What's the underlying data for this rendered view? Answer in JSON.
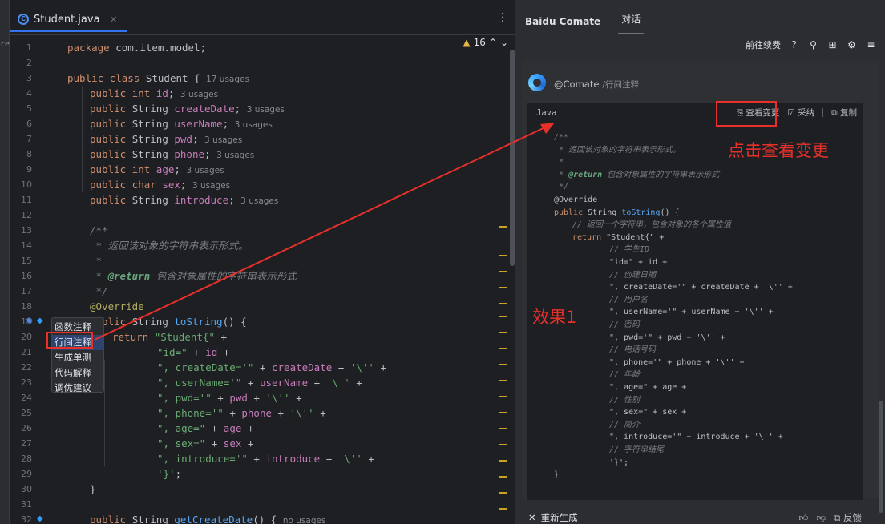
{
  "editor": {
    "tab_name": "Student.java",
    "tab_icon_letter": "C",
    "tab_close": "×",
    "kebab": "⋮",
    "warnings": "16",
    "left_fragment": "re\\",
    "line_numbers": [
      "1",
      "2",
      "3",
      "4",
      "5",
      "6",
      "7",
      "8",
      "9",
      "10",
      "11",
      "12",
      "13",
      "14",
      "15",
      "16",
      "17",
      "18",
      "19",
      "20",
      "21",
      "22",
      "23",
      "24",
      "25",
      "26",
      "27",
      "28",
      "29",
      "30",
      "31",
      "32"
    ]
  },
  "code_lines": [
    {
      "n": 0,
      "indent": 0,
      "parts": [
        [
          "kw",
          "package "
        ],
        [
          "t",
          "com.item.model;"
        ]
      ]
    },
    {
      "n": 2,
      "indent": 0,
      "parts": [
        [
          "kw",
          "public class "
        ],
        [
          "t",
          "Student { "
        ],
        [
          "hint",
          "17 usages"
        ]
      ]
    },
    {
      "n": 3,
      "indent": 1,
      "parts": [
        [
          "kw",
          "public int "
        ],
        [
          "fld",
          "id"
        ],
        [
          "t",
          "; "
        ],
        [
          "hint",
          "3 usages"
        ]
      ]
    },
    {
      "n": 4,
      "indent": 1,
      "parts": [
        [
          "kw",
          "public "
        ],
        [
          "t",
          "String "
        ],
        [
          "fld",
          "createDate"
        ],
        [
          "t",
          "; "
        ],
        [
          "hint",
          "3 usages"
        ]
      ]
    },
    {
      "n": 5,
      "indent": 1,
      "parts": [
        [
          "kw",
          "public "
        ],
        [
          "t",
          "String "
        ],
        [
          "fld",
          "userName"
        ],
        [
          "t",
          "; "
        ],
        [
          "hint",
          "3 usages"
        ]
      ]
    },
    {
      "n": 6,
      "indent": 1,
      "parts": [
        [
          "kw",
          "public "
        ],
        [
          "t",
          "String "
        ],
        [
          "fld",
          "pwd"
        ],
        [
          "t",
          "; "
        ],
        [
          "hint",
          "3 usages"
        ]
      ]
    },
    {
      "n": 7,
      "indent": 1,
      "parts": [
        [
          "kw",
          "public "
        ],
        [
          "t",
          "String "
        ],
        [
          "fld",
          "phone"
        ],
        [
          "t",
          "; "
        ],
        [
          "hint",
          "3 usages"
        ]
      ]
    },
    {
      "n": 8,
      "indent": 1,
      "parts": [
        [
          "kw",
          "public int "
        ],
        [
          "fld",
          "age"
        ],
        [
          "t",
          "; "
        ],
        [
          "hint",
          "3 usages"
        ]
      ]
    },
    {
      "n": 9,
      "indent": 1,
      "parts": [
        [
          "kw",
          "public char "
        ],
        [
          "fld",
          "sex"
        ],
        [
          "t",
          "; "
        ],
        [
          "hint",
          "3 usages"
        ]
      ]
    },
    {
      "n": 10,
      "indent": 1,
      "parts": [
        [
          "kw",
          "public "
        ],
        [
          "t",
          "String "
        ],
        [
          "fld",
          "introduce"
        ],
        [
          "t",
          "; "
        ],
        [
          "hint",
          "3 usages"
        ]
      ]
    },
    {
      "n": 12,
      "indent": 1,
      "parts": [
        [
          "cmt",
          "/**"
        ]
      ]
    },
    {
      "n": 13,
      "indent": 1,
      "parts": [
        [
          "cmt",
          " * 返回该对象的字符串表示形式。"
        ]
      ]
    },
    {
      "n": 14,
      "indent": 1,
      "parts": [
        [
          "cmt",
          " *"
        ]
      ]
    },
    {
      "n": 15,
      "indent": 1,
      "parts": [
        [
          "cmt",
          " * "
        ],
        [
          "tag",
          "@return"
        ],
        [
          "cmt",
          " 包含对象属性的字符串表示形式"
        ]
      ]
    },
    {
      "n": 16,
      "indent": 1,
      "parts": [
        [
          "cmt",
          " */"
        ]
      ]
    },
    {
      "n": 17,
      "indent": 1,
      "parts": [
        [
          "ann",
          "@Override"
        ]
      ]
    },
    {
      "n": 18,
      "indent": 1,
      "parts": [
        [
          "kw",
          "public "
        ],
        [
          "t",
          "String "
        ],
        [
          "fn",
          "toString"
        ],
        [
          "t",
          "() {"
        ]
      ]
    },
    {
      "n": 19,
      "indent": 2,
      "parts": [
        [
          "kw",
          "return "
        ],
        [
          "str",
          "\"Student{\""
        ],
        [
          "t",
          " +"
        ]
      ]
    },
    {
      "n": 20,
      "indent": 4,
      "parts": [
        [
          "str",
          "\"id=\""
        ],
        [
          "t",
          " + "
        ],
        [
          "fld",
          "id"
        ],
        [
          "t",
          " +"
        ]
      ]
    },
    {
      "n": 21,
      "indent": 4,
      "parts": [
        [
          "str",
          "\", createDate='\""
        ],
        [
          "t",
          " + "
        ],
        [
          "fld",
          "createDate"
        ],
        [
          "t",
          " + "
        ],
        [
          "str",
          "'\\''"
        ],
        [
          "t",
          " +"
        ]
      ]
    },
    {
      "n": 22,
      "indent": 4,
      "parts": [
        [
          "str",
          "\", userName='\""
        ],
        [
          "t",
          " + "
        ],
        [
          "fld",
          "userName"
        ],
        [
          "t",
          " + "
        ],
        [
          "str",
          "'\\''"
        ],
        [
          "t",
          " +"
        ]
      ]
    },
    {
      "n": 23,
      "indent": 4,
      "parts": [
        [
          "str",
          "\", pwd='\""
        ],
        [
          "t",
          " + "
        ],
        [
          "fld",
          "pwd"
        ],
        [
          "t",
          " + "
        ],
        [
          "str",
          "'\\''"
        ],
        [
          "t",
          " +"
        ]
      ]
    },
    {
      "n": 24,
      "indent": 4,
      "parts": [
        [
          "str",
          "\", phone='\""
        ],
        [
          "t",
          " + "
        ],
        [
          "fld",
          "phone"
        ],
        [
          "t",
          " + "
        ],
        [
          "str",
          "'\\''"
        ],
        [
          "t",
          " +"
        ]
      ]
    },
    {
      "n": 25,
      "indent": 4,
      "parts": [
        [
          "str",
          "\", age=\""
        ],
        [
          "t",
          " + "
        ],
        [
          "fld",
          "age"
        ],
        [
          "t",
          " +"
        ]
      ]
    },
    {
      "n": 26,
      "indent": 4,
      "parts": [
        [
          "str",
          "\", sex=\""
        ],
        [
          "t",
          " + "
        ],
        [
          "fld",
          "sex"
        ],
        [
          "t",
          " +"
        ]
      ]
    },
    {
      "n": 27,
      "indent": 4,
      "parts": [
        [
          "str",
          "\", introduce='\""
        ],
        [
          "t",
          " + "
        ],
        [
          "fld",
          "introduce"
        ],
        [
          "t",
          " + "
        ],
        [
          "str",
          "'\\''"
        ],
        [
          "t",
          " +"
        ]
      ]
    },
    {
      "n": 28,
      "indent": 4,
      "parts": [
        [
          "str",
          "'}'"
        ],
        [
          "t",
          ";"
        ]
      ]
    },
    {
      "n": 29,
      "indent": 1,
      "parts": [
        [
          "t",
          "}"
        ]
      ]
    },
    {
      "n": 31,
      "indent": 1,
      "parts": [
        [
          "kw",
          "public "
        ],
        [
          "t",
          "String "
        ],
        [
          "fn",
          "getCreateDate"
        ],
        [
          "t",
          "() { "
        ],
        [
          "hint",
          "no usages"
        ]
      ]
    }
  ],
  "popup_menu": [
    "函数注释",
    "行间注释",
    "生成单测",
    "代码解释",
    "调优建议"
  ],
  "panel": {
    "title": "Baidu Comate",
    "tab": "对话",
    "continue_label": "前往续费",
    "sender": "@Comate",
    "command": "/行间注释",
    "lang": "Java",
    "view_change": "查看变更",
    "adopt": "采纳",
    "copy": "复制",
    "regenerate": "重新生成",
    "feedback": "反馈",
    "icons": [
      "help-icon",
      "share-icon",
      "grid-icon",
      "settings-icon",
      "menu-icon"
    ]
  },
  "panel_code": [
    {
      "i": 0,
      "parts": [
        [
          "cmt",
          "/**"
        ]
      ]
    },
    {
      "i": 0,
      "parts": [
        [
          "cmt",
          " * 返回该对象的字符串表示形式。"
        ]
      ]
    },
    {
      "i": 0,
      "parts": [
        [
          "cmt",
          " *"
        ]
      ]
    },
    {
      "i": 0,
      "parts": [
        [
          "cmt",
          " * "
        ],
        [
          "tag",
          "@return"
        ],
        [
          "cmt",
          " 包含对象属性的字符串表示形式"
        ]
      ]
    },
    {
      "i": 0,
      "parts": [
        [
          "cmt",
          " */"
        ]
      ]
    },
    {
      "i": 0,
      "parts": [
        [
          "t",
          "@Override"
        ]
      ]
    },
    {
      "i": 0,
      "parts": [
        [
          "kw",
          "public "
        ],
        [
          "t",
          "String "
        ],
        [
          "fn",
          "toString"
        ],
        [
          "t",
          "() {"
        ]
      ]
    },
    {
      "i": 1,
      "parts": [
        [
          "cmt",
          "// 返回一个字符串，包含对象的各个属性值"
        ]
      ]
    },
    {
      "i": 1,
      "parts": [
        [
          "kw",
          "return "
        ],
        [
          "t",
          "\"Student{\" +"
        ]
      ]
    },
    {
      "i": 3,
      "parts": [
        [
          "cmt",
          "// 学生ID"
        ]
      ]
    },
    {
      "i": 3,
      "parts": [
        [
          "t",
          "\"id=\" + id +"
        ]
      ]
    },
    {
      "i": 3,
      "parts": [
        [
          "cmt",
          "// 创建日期"
        ]
      ]
    },
    {
      "i": 3,
      "parts": [
        [
          "t",
          "\", createDate='\" + createDate + '\\'' +"
        ]
      ]
    },
    {
      "i": 3,
      "parts": [
        [
          "cmt",
          "// 用户名"
        ]
      ]
    },
    {
      "i": 3,
      "parts": [
        [
          "t",
          "\", userName='\" + userName + '\\'' +"
        ]
      ]
    },
    {
      "i": 3,
      "parts": [
        [
          "cmt",
          "// 密码"
        ]
      ]
    },
    {
      "i": 3,
      "parts": [
        [
          "t",
          "\", pwd='\" + pwd + '\\'' +"
        ]
      ]
    },
    {
      "i": 3,
      "parts": [
        [
          "cmt",
          "// 电话号码"
        ]
      ]
    },
    {
      "i": 3,
      "parts": [
        [
          "t",
          "\", phone='\" + phone + '\\'' +"
        ]
      ]
    },
    {
      "i": 3,
      "parts": [
        [
          "cmt",
          "// 年龄"
        ]
      ]
    },
    {
      "i": 3,
      "parts": [
        [
          "t",
          "\", age=\" + age +"
        ]
      ]
    },
    {
      "i": 3,
      "parts": [
        [
          "cmt",
          "// 性别"
        ]
      ]
    },
    {
      "i": 3,
      "parts": [
        [
          "t",
          "\", sex=\" + sex +"
        ]
      ]
    },
    {
      "i": 3,
      "parts": [
        [
          "cmt",
          "// 简介"
        ]
      ]
    },
    {
      "i": 3,
      "parts": [
        [
          "t",
          "\", introduce='\" + introduce + '\\'' +"
        ]
      ]
    },
    {
      "i": 3,
      "parts": [
        [
          "cmt",
          "// 字符串结尾"
        ]
      ]
    },
    {
      "i": 3,
      "parts": [
        [
          "t",
          "'}';"
        ]
      ]
    },
    {
      "i": 0,
      "parts": [
        [
          "t",
          "}"
        ]
      ]
    }
  ],
  "annotations": {
    "click_view_change": "点击查看变更",
    "effect": "效果1"
  },
  "colors": {
    "highlight": "#e8302b",
    "accent": "#3574f0"
  }
}
